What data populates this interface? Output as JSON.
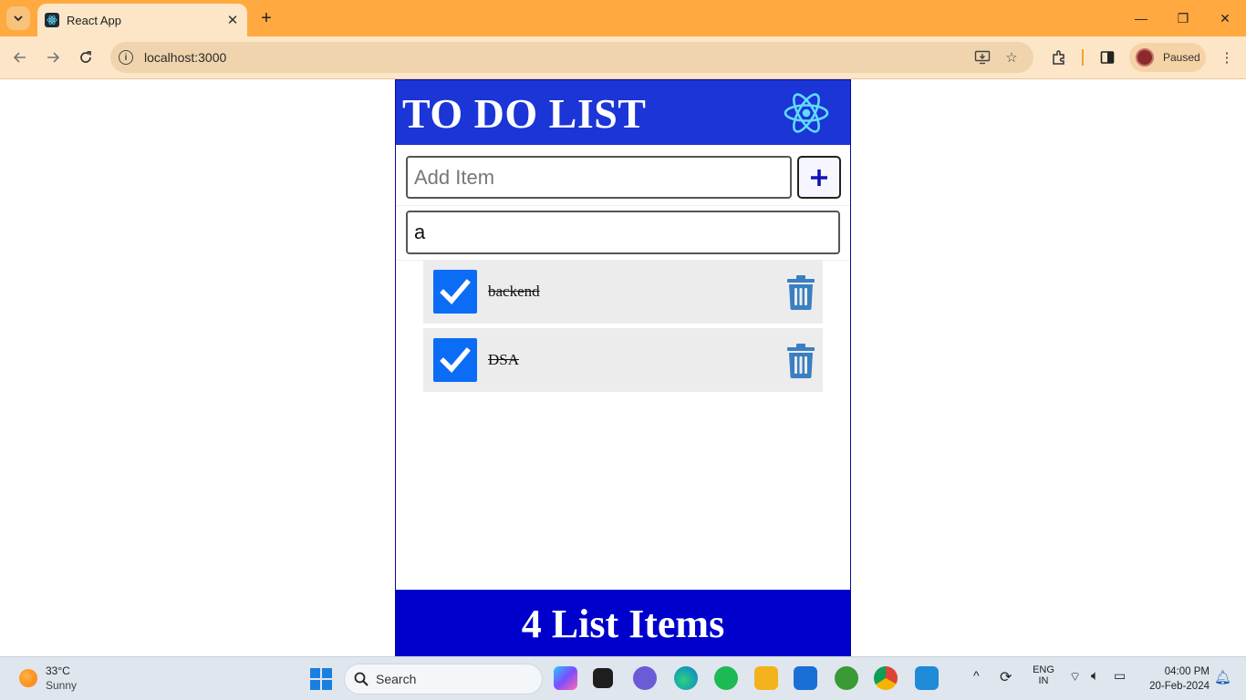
{
  "browser": {
    "tab_title": "React App",
    "url": "localhost:3000",
    "profile_label": "Paused"
  },
  "app": {
    "title": "TO DO LIST",
    "add_placeholder": "Add Item",
    "add_value": "",
    "search_value": "a",
    "items": [
      {
        "label": "backend",
        "checked": true
      },
      {
        "label": "DSA",
        "checked": true
      }
    ],
    "footer": "4 List Items",
    "colors": {
      "header_bg": "#1b35d6",
      "footer_bg": "#0000cc",
      "checkbox": "#0b6cf5",
      "trash": "#3a7fc2",
      "react_logo": "#61dafb"
    }
  },
  "taskbar": {
    "weather_temp": "33°C",
    "weather_condition": "Sunny",
    "search_label": "Search",
    "lang_line1": "ENG",
    "lang_line2": "IN",
    "time": "04:00 PM",
    "date": "20-Feb-2024"
  }
}
